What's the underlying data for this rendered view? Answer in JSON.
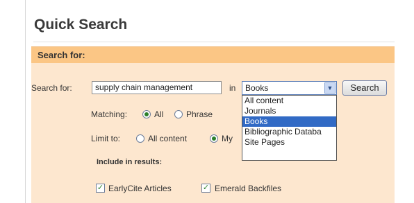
{
  "title": "Quick Search",
  "section_header": "Search for:",
  "search_row": {
    "label": "Search for:",
    "query": "supply chain management",
    "in_label": "in",
    "selected_scope": "Books",
    "button": "Search"
  },
  "scope_dropdown": {
    "options": [
      "All content",
      "Journals",
      "Books",
      "Bibliographic Databa",
      "Site Pages"
    ],
    "selected_index": 2
  },
  "matching": {
    "label": "Matching:",
    "options": [
      "All",
      "Phrase"
    ],
    "selected": "All"
  },
  "limit_to": {
    "label": "Limit to:",
    "options": [
      "All content",
      "My"
    ],
    "selected": "My"
  },
  "include": {
    "label": "Include in results:",
    "options": [
      {
        "label": "EarlyCite Articles",
        "checked": true
      },
      {
        "label": "Emerald Backfiles",
        "checked": true
      }
    ]
  },
  "colors": {
    "header_bar": "#fbc685",
    "form_bg": "#fde7cf",
    "selection": "#316ac5",
    "checkmark": "#2a7f2a"
  }
}
